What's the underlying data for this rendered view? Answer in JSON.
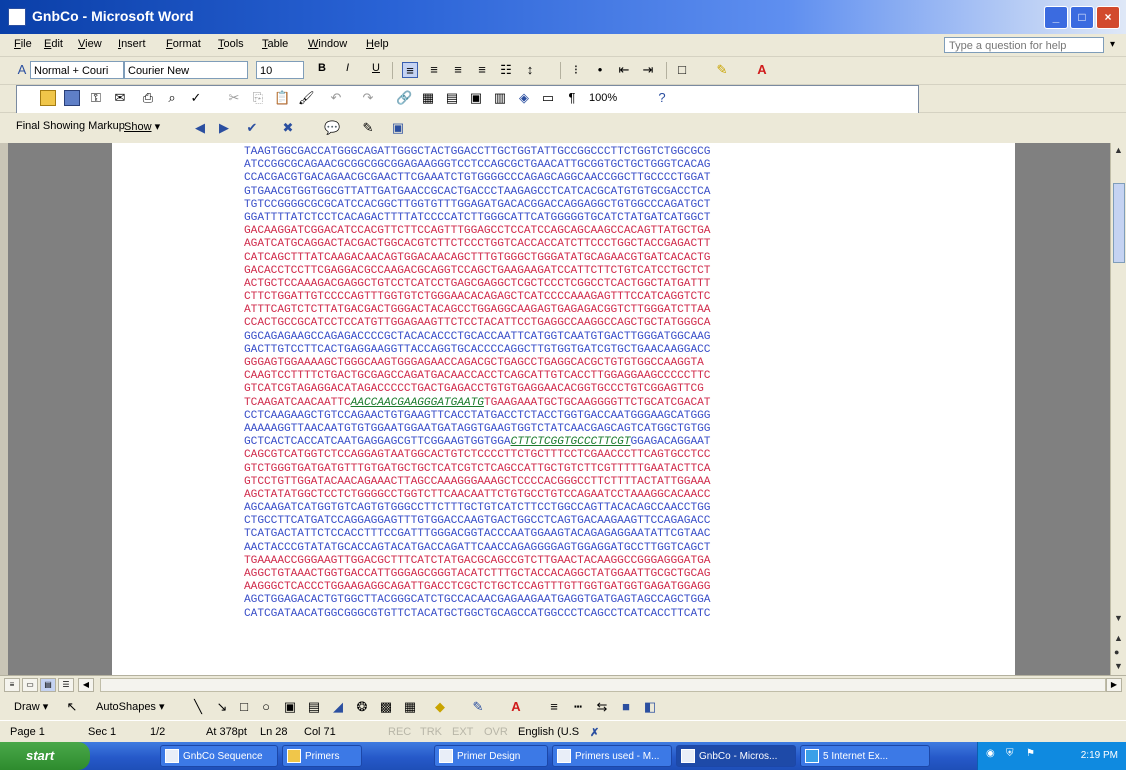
{
  "window": {
    "title": "GnbCo - Microsoft Word"
  },
  "menu": [
    "File",
    "Edit",
    "View",
    "Insert",
    "Format",
    "Tools",
    "Table",
    "Window",
    "Help"
  ],
  "help_placeholder": "Type a question for help",
  "formatting": {
    "style": "Normal + Couri",
    "font": "Courier New",
    "size": "10",
    "bold": "B",
    "italic": "I",
    "underline": "U"
  },
  "standard": {
    "zoom": "100%"
  },
  "reviewing": {
    "markup": "Final Showing Markup",
    "show": "Show"
  },
  "drawing": {
    "draw": "Draw",
    "autoshapes": "AutoShapes"
  },
  "dna_lines": [
    [
      {
        "t": "TAAGTGGCGACCATGGGCAGATTGGGCTACTGGACCTTGCTGGTATTGCCGGCCCTTCTGGTCTGGCGCG",
        "c": "b"
      }
    ],
    [
      {
        "t": "ATCCGGCGCAGAACGCGGCGGCGGAGAAGGGTCCTCCAGCGCTGAACATTGCGGTGCTGCTGGGTCACAG",
        "c": "b"
      }
    ],
    [
      {
        "t": "CCACGACGTGACAGAACGCGAACTTCGAAATCTGTGGGGCCCAGAGCAGGCAACCGGCTTGCCCCTGGAT",
        "c": "b"
      }
    ],
    [
      {
        "t": "GTGAACGTGGTGGCGTTATTGATGAACCGCACTGACCCTAAGAGCCTCATCACGCATGTGTGCGACCTCA",
        "c": "b"
      }
    ],
    [
      {
        "t": "TGTCCGGGGCGCGCATCCACGGCTTGGTGTTTGGAGATGACACGGACCAGGAGGCTGTGGCCCAGATGCT",
        "c": "b"
      }
    ],
    [
      {
        "t": "GGATTTTATCTCCTCACAGACTTTTATCCCCATCTTGGGCATTCATGGGGGTGCATCTATGATCATGGCT",
        "c": "b"
      }
    ],
    [
      {
        "t": "GACAAGGATCGGACATCCACGTTCTTCCAGTTTGGAGCCTCCATCCAGCAGCAAGCCACAGTTATGCTGA",
        "c": "r"
      }
    ],
    [
      {
        "t": "AGATCATGCAGGACTACGACTGGCACGTCTTCTCCCTGGTCACCACCATCTTCCCTGGCTACCGAGACTT",
        "c": "r"
      }
    ],
    [
      {
        "t": "CATCAGCTTTATCAAGACAACAGTGGACAACAGCTTTGTGGGCTGGGATATGCAGAACGTGATCACACTG",
        "c": "r"
      }
    ],
    [
      {
        "t": "GACACCTCCTTCGAGGACGCCAAGACGCAGGTCCAGCTGAAGAAGATCCATTCTTCTGTCATCCTGCTCT",
        "c": "r"
      }
    ],
    [
      {
        "t": "ACTGCTCCAAAGACGAGGCTGTCCTCATCCTGAGCGAGGCTCGCTCCCTCGGCCTCACTGGCTATGATTT",
        "c": "r"
      }
    ],
    [
      {
        "t": "CTTCTGGATTGTCCCCAGTTTGGTGTCTGGGAACACAGAGCTCATCCCCAAAGAGTTTCCATCAGGTCTC",
        "c": "r"
      }
    ],
    [
      {
        "t": "ATTTCAGTCTCTTATGACGACTGGGACTACAGCCTGGAGGCAAGAGTGAGAGACGGTCTTGGGATCTTAA",
        "c": "r"
      }
    ],
    [
      {
        "t": "CCACTGCCGCATCCTCCATGTTGGAGAAGTTCTCCTACATTCCTGAGGCCAAGGCCAGCTGCTATGGGCA",
        "c": "r"
      }
    ],
    [
      {
        "t": "GGCAGAGAAGCCAGAGACCCCGCTACACACCCTGCACCAATTCATGGTCAATGTGACTTGGGATGGCAAG",
        "c": "b"
      }
    ],
    [
      {
        "t": "GACTTGTCCTTCACTGAGGAAGGTTACCAGGTGCACCCCAGGCTTGTGGTGATCGTGCTGAACAAGGACC",
        "c": "b"
      }
    ],
    [
      {
        "t": "GGGAGTGGAAAAGCTGGGCAAGTGGGAGAACCAGACGCTGAGCCTGAGGCACGCTGTGTGGCCAAGGTA",
        "c": "r"
      }
    ],
    [
      {
        "t": "CAAGTCCTTTTCTGACTGCGAGCCAGATGACAACCACCTCAGCATTGTCACCTTGGAGGAAGCCCCCTTC",
        "c": "r"
      }
    ],
    [
      {
        "t": "GTCATCGTAGAGGACATAGACCCCCTGACTGAGACCTGTGTGAGGAACACGGTGCCCTGTCGGAGTTCG",
        "c": "r"
      }
    ],
    [
      {
        "t": "TCAAGATCAACAATTC",
        "c": "r"
      },
      {
        "t": "AACCAACGAAGGGATGAATG",
        "c": "g"
      },
      {
        "t": "TGAAGAAATGCTGCAAGGGGTTCTGCATCGACAT",
        "c": "r"
      }
    ],
    [
      {
        "t": "CCTCAAGAAGCTGTCCAGAACTGTGAAGTTCACCTATGACCTCTACCTGGTGACCAATGGGAAGCATGGG",
        "c": "b"
      }
    ],
    [
      {
        "t": "AAAAAGGTTAACAATGTGTGGAATGGAATGATAGGTGAAGTGGTCTATCAACGAGCAGTCATGGCTGTGG",
        "c": "b"
      }
    ],
    [
      {
        "t": "GCTCACTCACCATCAATGAGGAGCGTTCGGAAGTGGTGGA",
        "c": "b"
      },
      {
        "t": "CTTCTCGGTGCCCTTCGT",
        "c": "g"
      },
      {
        "t": "GGAGACAGGAAT",
        "c": "b"
      }
    ],
    [
      {
        "t": "CAGCGTCATGGTCTCCAGGAGTAATGGCACTGTCTCCCCTTCTGCTTTCCTCGAACCCTTCAGTGCCTCC",
        "c": "r"
      }
    ],
    [
      {
        "t": "GTCTGGGTGATGATGTTTGTGATGCTGCTCATCGTCTCAGCCATTGCTGTCTTCGTTTTTGAATACTTCA",
        "c": "r"
      }
    ],
    [
      {
        "t": "GTCCTGTTGGATACAACAGAAACTTAGCCAAAGGGAAAGCTCCCCACGGGCCTTCTTTTACTATTGGAAA",
        "c": "r"
      }
    ],
    [
      {
        "t": "AGCTATATGGCTCCTCTGGGGCCTGGTCTTCAACAATTCTGTGCCTGTCCAGAATCCTAAAGGCACAACC",
        "c": "r"
      }
    ],
    [
      {
        "t": "AGCAAGATCATGGTGTCAGTGTGGGCCTTCTTTGCTGTCATCTTCCTGGCCAGTTACACAGCCAACCTGG",
        "c": "b"
      }
    ],
    [
      {
        "t": "CTGCCTTCATGATCCAGGAGGAGTTTGTGGACCAAGTGACTGGCCTCAGTGACAAGAAGTTCCAGAGACC",
        "c": "b"
      }
    ],
    [
      {
        "t": "TCATGACTATTCTCCACCTTTCCGATTTGGGACGGTACCCAATGGAAGTACAGAGAGGAATATTCGTAAC",
        "c": "b"
      }
    ],
    [
      {
        "t": "AACTACCCGTATATGCACCAGTACATGACCAGATTCAACCAGAGGGGAGTGGAGGATGCCTTGGTCAGCT",
        "c": "b"
      }
    ],
    [
      {
        "t": "TGAAAACCGGGAAGTTGGACGCTTTCATCTATGACGCAGCCGTCTTGAACTACAAGGCCGGGAGGGATGA",
        "c": "r"
      }
    ],
    [
      {
        "t": "AGGCTGTAAACTGGTGACCATTGGGAGCGGGTACATCTTTGCTACCACAGGCTATGGAATTGCGCTGCAG",
        "c": "r"
      }
    ],
    [
      {
        "t": "AAGGGCTCACCCTGGAAGAGGCAGATTGACCTCGCTCTGCTCCAGTTTGTTGGTGATGGTGAGATGGAGG",
        "c": "r"
      }
    ],
    [
      {
        "t": "AGCTGGAGACACTGTGGCTTACGGGCATCTGCCACAACGAGAAGAATGAGGTGATGAGTAGCCAGCTGGA",
        "c": "b"
      }
    ],
    [
      {
        "t": "CATCGATAACATGGCGGGCGTGTTCTACATGCTGGCTGCAGCCATGGCCCTCAGCCTCATCACCTTCATC",
        "c": "b"
      }
    ]
  ],
  "status": {
    "page": "Page 1",
    "sec": "Sec 1",
    "pages": "1/2",
    "at": "At 378pt",
    "ln": "Ln 28",
    "col": "Col 71",
    "rec": "REC",
    "trk": "TRK",
    "ext": "EXT",
    "ovr": "OVR",
    "lang": "English (U.S"
  },
  "taskbar": {
    "start": "start",
    "items": [
      "GnbCo Sequence",
      "Primers",
      "Primer Design",
      "Primers used - M...",
      "GnbCo - Micros...",
      "5 Internet Ex..."
    ],
    "clock": "2:19 PM"
  }
}
